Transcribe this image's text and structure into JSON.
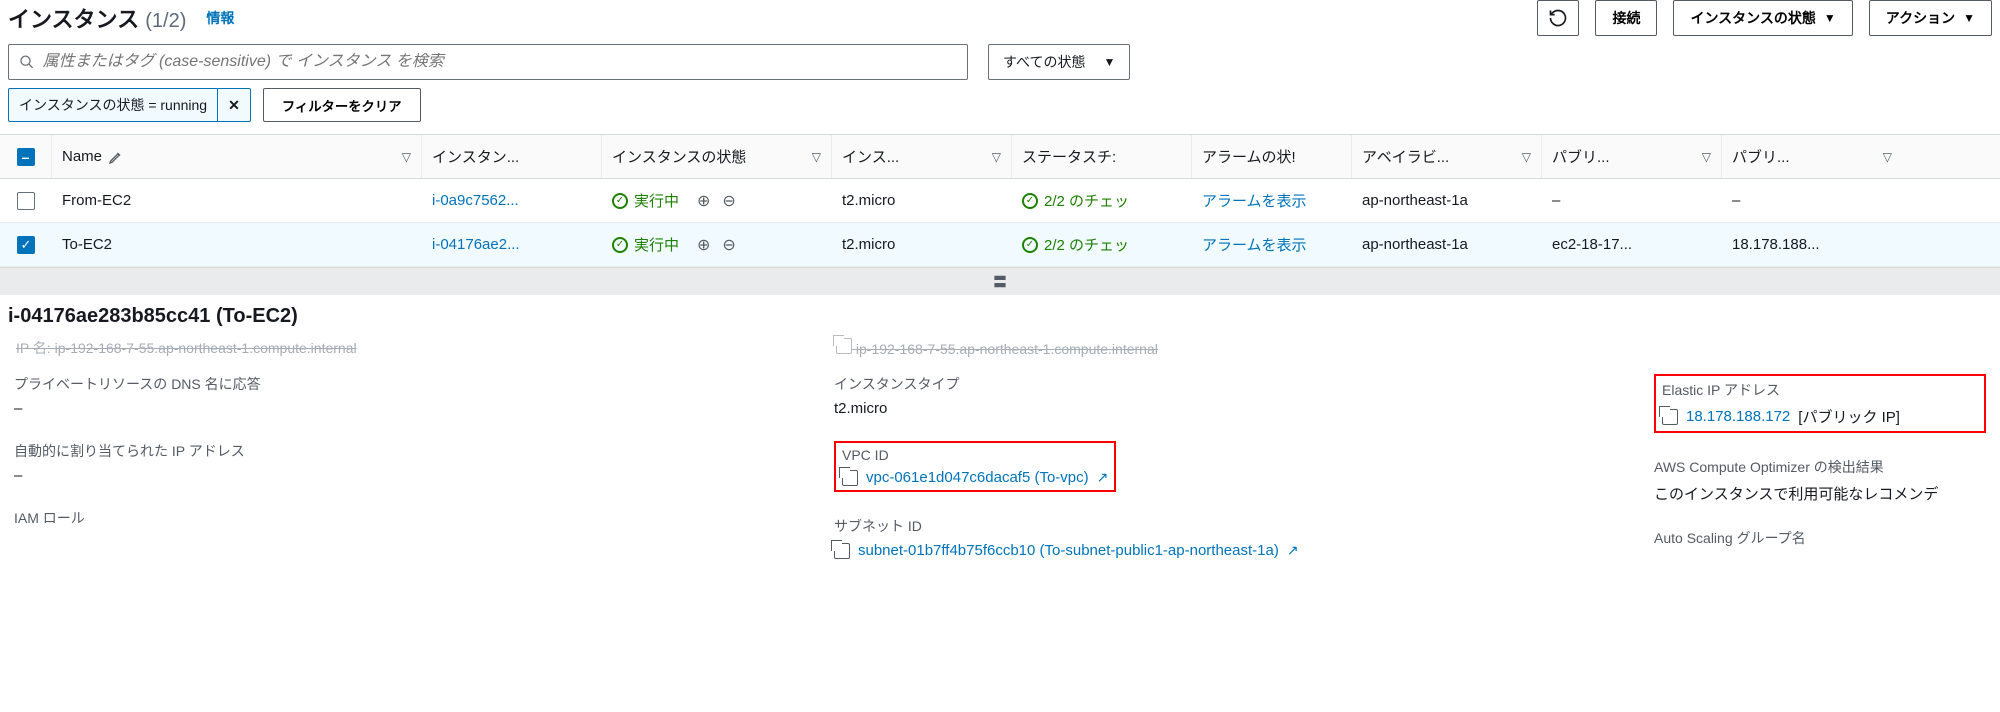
{
  "header": {
    "title": "インスタンス",
    "count": "(1/2)",
    "info": "情報",
    "buttons": {
      "connect": "接続",
      "instance_state": "インスタンスの状態",
      "actions": "アクション"
    }
  },
  "search": {
    "placeholder": "属性またはタグ (case-sensitive) で インスタンス を検索",
    "state_filter": "すべての状態"
  },
  "chips": {
    "running": "インスタンスの状態 = running",
    "clear": "フィルターをクリア"
  },
  "columns": {
    "name": "Name",
    "instance_id": "インスタン...",
    "instance_state": "インスタンスの状態",
    "instance_type": "インス...",
    "status_check": "ステータスチ:",
    "alarm_status": "アラームの状!",
    "az": "アベイラビ...",
    "public_dns": "パブリ...",
    "public_ip": "パブリ..."
  },
  "rows": [
    {
      "name": "From-EC2",
      "instance_id": "i-0a9c7562...",
      "state": "実行中",
      "type": "t2.micro",
      "status_check": "2/2 のチェッ",
      "alarm": "アラームを表示",
      "az": "ap-northeast-1a",
      "public_dns": "–",
      "public_ip": "–",
      "selected": false
    },
    {
      "name": "To-EC2",
      "instance_id": "i-04176ae2...",
      "state": "実行中",
      "type": "t2.micro",
      "status_check": "2/2 のチェッ",
      "alarm": "アラームを表示",
      "az": "ap-northeast-1a",
      "public_dns": "ec2-18-17...",
      "public_ip": "18.178.188...",
      "selected": true
    }
  ],
  "detail": {
    "title": "i-04176ae283b85cc41 (To-EC2)",
    "cutoff_left": "IP 名: ip-192-168-7-55.ap-northeast-1.compute.internal",
    "cutoff_mid": "ip-192-168-7-55.ap-northeast-1.compute.internal",
    "col1": {
      "dns_resp_label": "プライベートリソースの DNS 名に応答",
      "dns_resp_value": "–",
      "auto_ip_label": "自動的に割り当てられた IP アドレス",
      "auto_ip_value": "–",
      "iam_label": "IAM ロール"
    },
    "col2": {
      "itype_label": "インスタンスタイプ",
      "itype_value": "t2.micro",
      "vpc_label": "VPC ID",
      "vpc_value": "vpc-061e1d047c6dacaf5 (To-vpc)",
      "subnet_label": "サブネット ID",
      "subnet_value": "subnet-01b7ff4b75f6ccb10 (To-subnet-public1-ap-northeast-1a)"
    },
    "col3": {
      "eip_label": "Elastic IP アドレス",
      "eip_value": "18.178.188.172",
      "eip_suffix": "[パブリック IP]",
      "cop_label": "AWS Compute Optimizer の検出結果",
      "cop_value": "このインスタンスで利用可能なレコメンデ",
      "asg_label": "Auto Scaling グループ名"
    }
  }
}
